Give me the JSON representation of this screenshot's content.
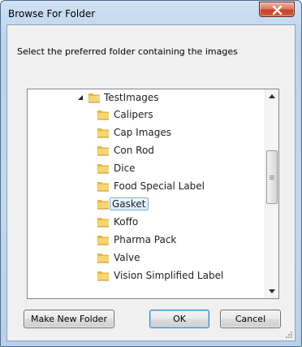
{
  "window": {
    "title": "Browse For Folder"
  },
  "dialog": {
    "instruction": "Select the preferred folder containing the images"
  },
  "tree": {
    "parent": {
      "label": "TestImages",
      "expanded": true,
      "icon": "folder-icon"
    },
    "items": [
      {
        "label": "Calipers",
        "selected": false,
        "icon": "folder-icon"
      },
      {
        "label": "Cap Images",
        "selected": false,
        "icon": "folder-icon"
      },
      {
        "label": "Con Rod",
        "selected": false,
        "icon": "folder-icon"
      },
      {
        "label": "Dice",
        "selected": false,
        "icon": "folder-icon"
      },
      {
        "label": "Food Special Label",
        "selected": false,
        "icon": "folder-icon"
      },
      {
        "label": "Gasket",
        "selected": true,
        "icon": "folder-icon"
      },
      {
        "label": "Koffo",
        "selected": false,
        "icon": "folder-icon"
      },
      {
        "label": "Pharma Pack",
        "selected": false,
        "icon": "folder-icon"
      },
      {
        "label": "Valve",
        "selected": false,
        "icon": "folder-icon"
      },
      {
        "label": "Vision Simplified Label",
        "selected": false,
        "icon": "folder-icon"
      }
    ]
  },
  "buttons": {
    "new_folder": "Make New Folder",
    "ok": "OK",
    "cancel": "Cancel"
  },
  "colors": {
    "selection_border": "#84acdd",
    "close_button": "#c7432a",
    "folder_yellow": "#f1c75a"
  }
}
